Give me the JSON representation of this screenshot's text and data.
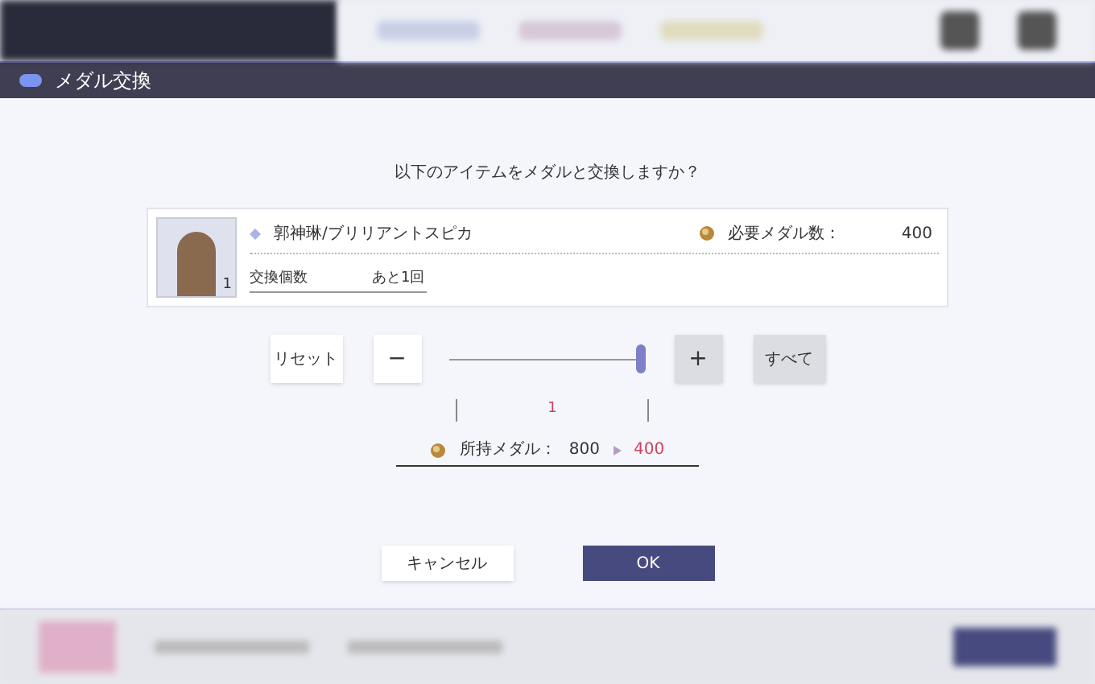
{
  "dialog": {
    "title": "メダル交換",
    "prompt": "以下のアイテムをメダルと交換しますか？",
    "item": {
      "name": "郭神琳/ブリリアントスピカ",
      "count": "1",
      "cost_label": "必要メダル数：",
      "cost": "400",
      "exchange_label": "交換個数",
      "remaining": "あと1回"
    },
    "controls": {
      "reset": "リセット",
      "minus": "−",
      "plus": "+",
      "all": "すべて",
      "level": 1,
      "quantity": "1"
    },
    "balance": {
      "label": "所持メダル：",
      "current": "800",
      "after": "400"
    },
    "buttons": {
      "cancel": "キャンセル",
      "ok": "OK"
    }
  }
}
